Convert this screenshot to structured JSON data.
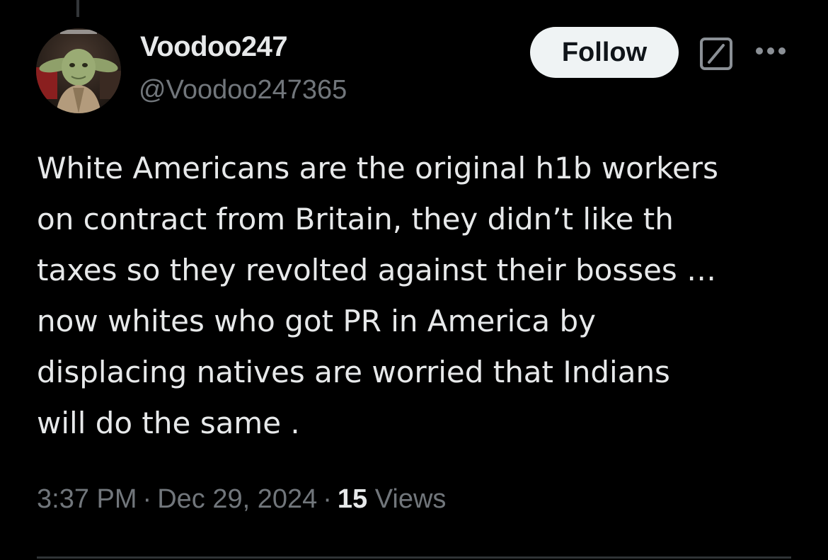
{
  "author": {
    "display_name": "Voodoo247",
    "handle": "@Voodoo247365",
    "avatar": "yoda-avatar"
  },
  "actions": {
    "follow_label": "Follow",
    "grok_icon": "grok-icon",
    "more_icon": "more-options-icon"
  },
  "tweet": {
    "lines": [
      "White Americans are the original h1b workers",
      "on contract from Britain, they didn’t like th",
      "taxes so they revolted against their bosses …",
      "now whites who got PR in America by",
      "displacing natives are worried that Indians",
      "will do the same ."
    ]
  },
  "meta": {
    "time": "3:37 PM",
    "separator": "·",
    "date": "Dec 29, 2024",
    "views_count": "15",
    "views_label": "Views"
  },
  "colors": {
    "background": "#000000",
    "primary_text": "#e7e9ea",
    "secondary_text": "#71767b",
    "follow_bg": "#eff3f4",
    "follow_text": "#0f1419",
    "divider": "#2f3336"
  }
}
